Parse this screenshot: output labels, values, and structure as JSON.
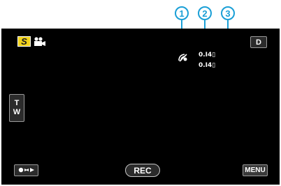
{
  "callouts": [
    "1",
    "2",
    "3"
  ],
  "mode_indicator": {
    "label": "S",
    "icon": "movie-camera-icon"
  },
  "display_button": {
    "label": "D"
  },
  "status_icons": {
    "gps_icon": "gps-satellite-icon",
    "row1": "0.I4▯",
    "row2": "0.I4▯"
  },
  "zoom_button": {
    "t": "T",
    "w": "W"
  },
  "playback_button": {
    "icon": "record-playback-switch-icon"
  },
  "rec_button": {
    "label": "REC"
  },
  "menu_button": {
    "label": "MENU"
  },
  "colors": {
    "accent": "#1a9fd6",
    "mode": "#f2d21b",
    "screen": "#000000"
  }
}
